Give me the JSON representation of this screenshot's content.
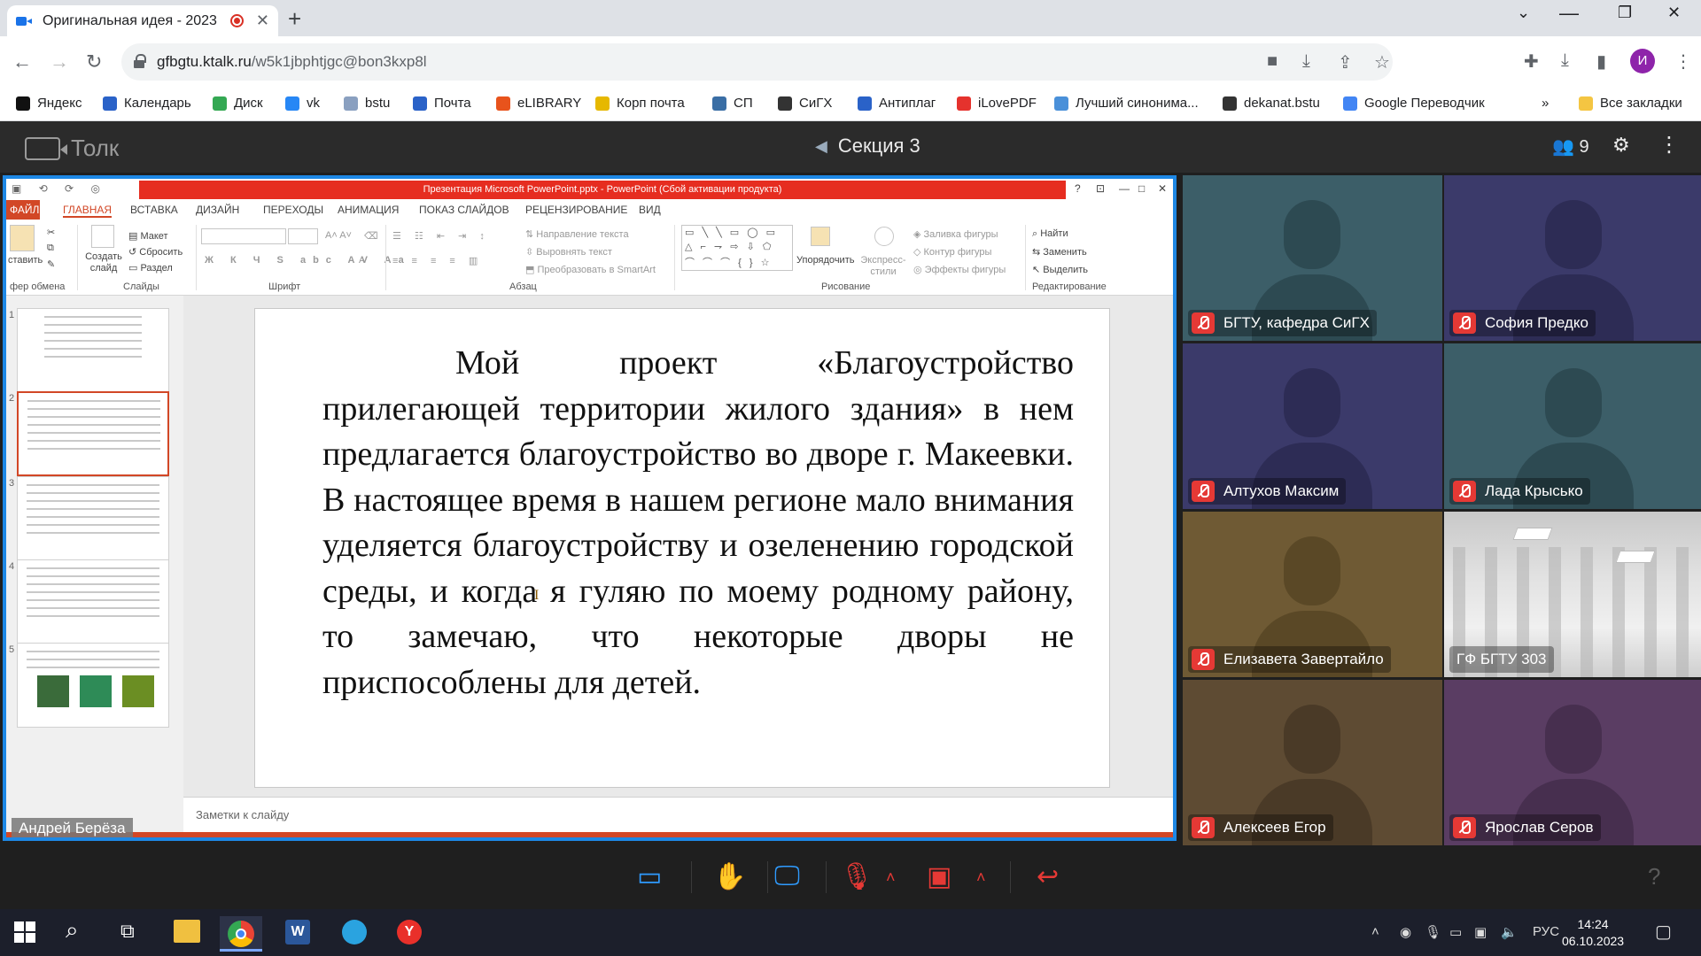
{
  "browser": {
    "tab_title": "Оригинальная идея - 2023",
    "url_host": "gfbgtu.ktalk.ru",
    "url_path": "/w5k1jbphtjgc@bon3kxp8l",
    "profile_initial": "И",
    "bookmarks": [
      {
        "label": "Яндекс",
        "icon": "yandex-icon",
        "color": "#111111"
      },
      {
        "label": "Календарь",
        "icon": "calendar-icon",
        "color": "#2a62c8"
      },
      {
        "label": "Диск",
        "icon": "drive-icon",
        "color": "#34a853"
      },
      {
        "label": "vk",
        "icon": "vk-icon",
        "color": "#2787f5"
      },
      {
        "label": "bstu",
        "icon": "bstu-icon",
        "color": "#8aa0c0"
      },
      {
        "label": "Почта",
        "icon": "mail-icon",
        "color": "#2a62c8"
      },
      {
        "label": "eLIBRARY",
        "icon": "elibrary-icon",
        "color": "#e8531c"
      },
      {
        "label": "Корп почта",
        "icon": "corp-mail-icon",
        "color": "#e6b800"
      },
      {
        "label": "СП",
        "icon": "sp-icon",
        "color": "#3a6ea5"
      },
      {
        "label": "СиГХ",
        "icon": "sigh-icon",
        "color": "#333333"
      },
      {
        "label": "Антиплаг",
        "icon": "antiplag-icon",
        "color": "#2a62c8"
      },
      {
        "label": "iLovePDF",
        "icon": "ilovepdf-icon",
        "color": "#e5322d"
      },
      {
        "label": "Лучший синонима...",
        "icon": "synonym-icon",
        "color": "#4a90d9"
      },
      {
        "label": "dekanat.bstu",
        "icon": "dekanat-icon",
        "color": "#333333"
      },
      {
        "label": "Google Переводчик",
        "icon": "translate-icon",
        "color": "#4285f4"
      }
    ],
    "overflow": "»",
    "all_bookmarks": "Все закладки"
  },
  "talk": {
    "app_name": "Толк",
    "session_title": "Секция 3",
    "participants_count": "9"
  },
  "ppt": {
    "title": "Презентация Microsoft PowerPoint.pptx - PowerPoint (Сбой активации продукта)",
    "tabs": [
      "ФАЙЛ",
      "ГЛАВНАЯ",
      "ВСТАВКА",
      "ДИЗАЙН",
      "ПЕРЕХОДЫ",
      "АНИМАЦИЯ",
      "ПОКАЗ СЛАЙДОВ",
      "РЕЦЕНЗИРОВАНИЕ",
      "ВИД"
    ],
    "ribbon": {
      "paste": "ставить",
      "create_slide": "Создать слайд",
      "layout": "Макет",
      "reset": "Сбросить",
      "section": "Раздел",
      "clipboard": "фер обмена",
      "slides": "Слайды",
      "font": "Шрифт",
      "paragraph": "Абзац",
      "text_dir": "Направление текста",
      "align_text": "Выровнять текст",
      "smartart": "Преобразовать в SmartArt",
      "arrange": "Упорядочить",
      "express": "Экспресс-стили",
      "fill": "Заливка фигуры",
      "outline": "Контур фигуры",
      "effects": "Эффекты фигуры",
      "drawing": "Рисование",
      "find": "Найти",
      "replace": "Заменить",
      "select": "Выделить",
      "editing": "Редактирование"
    },
    "slide_numbers": [
      "1",
      "2",
      "3",
      "4",
      "5"
    ],
    "slide_text": "Мой проект «Благоустройство прилегающей территории жилого здания» в нем предлагается благоустройство во дворе г. Макеевки. В настоящее время в нашем регионе мало внимания уделяется благоустройству и озеленению городской среды, и когда я гуляю по моему родному району, то замечаю, что некоторые дворы не приспособлены для детей.",
    "notes_placeholder": "Заметки к слайду",
    "presenter": "Андрей Берёза"
  },
  "participants": [
    {
      "name": "БГТУ, кафедра СиГХ",
      "bg": "#3c5e68",
      "fg": "#2d4a52"
    },
    {
      "name": "София Предко",
      "bg": "#3b3a6a",
      "fg": "#2d2c55"
    },
    {
      "name": "Алтухов Максим",
      "bg": "#3b3a6a",
      "fg": "#2d2c55"
    },
    {
      "name": "Лада Крысько",
      "bg": "#3c5e68",
      "fg": "#2d4a52"
    },
    {
      "name": "Елизавета Завертайло",
      "bg": "#6f5a34",
      "fg": "#5a4826"
    },
    {
      "name": "ГФ БГТУ 303",
      "bg": "#d8d8d8",
      "fg": "#d8d8d8"
    },
    {
      "name": "Алексеев Егор",
      "bg": "#5e4b33",
      "fg": "#4a3a27"
    },
    {
      "name": "Ярослав Серов",
      "bg": "#5a3d63",
      "fg": "#472f4f"
    }
  ],
  "taskbar": {
    "lang": "РУС",
    "time": "14:24",
    "date": "06.10.2023"
  }
}
